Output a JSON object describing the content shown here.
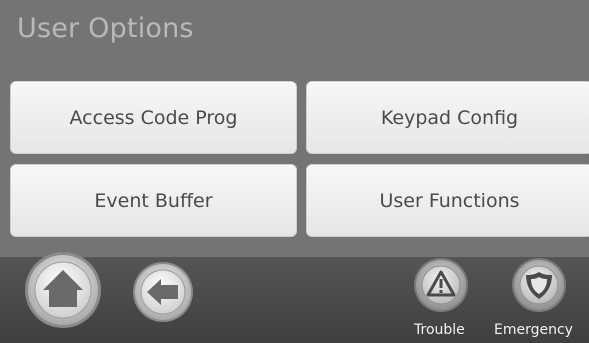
{
  "header": {
    "title": "User Options"
  },
  "menu": {
    "access_code_prog": "Access Code Prog",
    "keypad_config": "Keypad Config",
    "event_buffer": "Event Buffer",
    "user_functions": "User Functions"
  },
  "bottom_bar": {
    "trouble_label": "Trouble",
    "emergency_label": "Emergency",
    "icons": [
      "home-icon",
      "back-arrow-icon",
      "warning-triangle-icon",
      "shield-icon"
    ]
  },
  "colors": {
    "screen_bg": "#747474",
    "title_text": "#b9b9b9",
    "button_face": "#efefef",
    "button_text": "#4a4a4a",
    "bar_bg": "#4a4a4a"
  }
}
